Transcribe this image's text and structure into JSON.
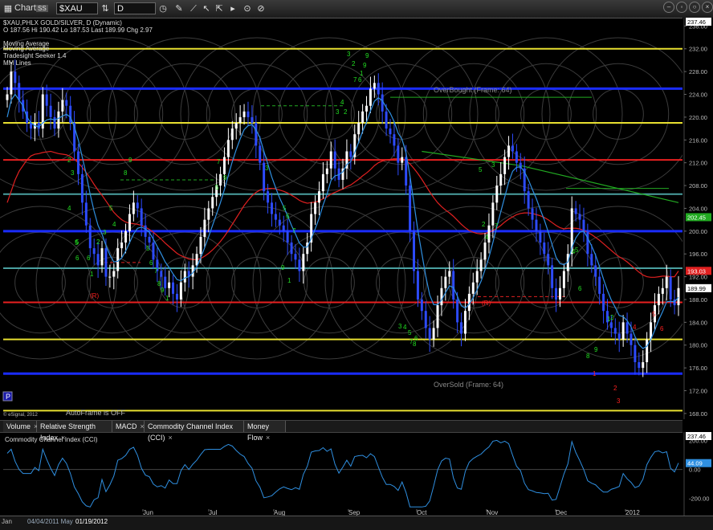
{
  "toolbar": {
    "chart_label": "Chart",
    "chart_badge": "SS",
    "symbol": "$XAU",
    "interval": "D"
  },
  "header": {
    "title_line": "$XAU,PHLX GOLD/SILVER, D (Dynamic)",
    "ohlc": "O  187.56  Hi  190.42   Lo  187.53   Last  189.99   Chg  2.97",
    "studies": [
      "Moving Average",
      "Moving Average",
      "Tradesight Seeker 1.4",
      "MM Lines"
    ]
  },
  "annotations": {
    "overbought": "OverBought (Frame: 64)",
    "oversold": "OverSold (Frame: 64)",
    "autoframe": "AutoFrame is OFF",
    "copyright": "© eSignal, 2012",
    "p_button": "P"
  },
  "colors": {
    "background": "#000000",
    "up_candle": "#ffffff",
    "down_candle": "#2d4bff",
    "ma_fast": "#2f8fe0",
    "ma_slow_red": "#e02020",
    "ma_slow_green": "#22aa22",
    "mm_yellow": "#e8e030",
    "mm_red": "#e82020",
    "mm_blue": "#1a2cff",
    "mm_teal": "#4aa0a0",
    "mm_green": "#228822",
    "cci_line": "#2f8fe0",
    "seeker_green": "#22dd22",
    "seeker_red": "#ff2020"
  },
  "tabs": [
    {
      "label": "Volume"
    },
    {
      "label": "Relative Strength Index"
    },
    {
      "label": "MACD"
    },
    {
      "label": "Commodity Channel Index (CCI)"
    },
    {
      "label": "Money Flow"
    }
  ],
  "chart_data": [
    {
      "type": "candlestick",
      "title": "$XAU,PHLX GOLD/SILVER, D (Dynamic)",
      "y_axis": {
        "ylim": [
          167,
          237.46
        ],
        "ticks": [
          168,
          172,
          176,
          180,
          184,
          188,
          192,
          196,
          200,
          204,
          208,
          212,
          216,
          220,
          224,
          228,
          232,
          236
        ]
      },
      "x_ticks": [
        "Jun",
        "Jul",
        "Aug",
        "Sep",
        "Oct",
        "Nov",
        "Dec",
        "2012"
      ],
      "badges": [
        {
          "value": "237.46",
          "color": "#ffffff"
        },
        {
          "value": "202.45",
          "color": "#22aa22"
        },
        {
          "value": "193.03",
          "color": "#e02020"
        },
        {
          "value": "189.99",
          "color": "#ffffff"
        }
      ],
      "horizontal_lines": [
        {
          "value": 232,
          "color": "#e8e030"
        },
        {
          "value": 225,
          "color": "#1a2cff"
        },
        {
          "value": 219,
          "color": "#e8e030"
        },
        {
          "value": 212.5,
          "color": "#e82020"
        },
        {
          "value": 206.5,
          "color": "#4aa0a0"
        },
        {
          "value": 200,
          "color": "#1a2cff"
        },
        {
          "value": 193.5,
          "color": "#4aa0a0"
        },
        {
          "value": 187.5,
          "color": "#e82020"
        },
        {
          "value": 181,
          "color": "#e8e030"
        },
        {
          "value": 175,
          "color": "#1a2cff"
        },
        {
          "value": 168.5,
          "color": "#e8e030"
        }
      ],
      "close": [
        224,
        228,
        226,
        223,
        221,
        219,
        218,
        219,
        218,
        224,
        222,
        220,
        218,
        221,
        223,
        222,
        219,
        214,
        210,
        205,
        201,
        197,
        196,
        194,
        197,
        192,
        192,
        193,
        197,
        198,
        200,
        203,
        205,
        204,
        201,
        199,
        198,
        195,
        193,
        192,
        190,
        191,
        189,
        188,
        191,
        193,
        192,
        194,
        196,
        199,
        202,
        204,
        206,
        208,
        210,
        213,
        216,
        218,
        219,
        220,
        221,
        220,
        219,
        215,
        212,
        207,
        205,
        203,
        202,
        201,
        200,
        198,
        196,
        195,
        193,
        196,
        198,
        203,
        205,
        207,
        210,
        211,
        214,
        211,
        209,
        211,
        214,
        213,
        217,
        219,
        221,
        222,
        225,
        226,
        224,
        221,
        218,
        217,
        215,
        212,
        213,
        208,
        200,
        193,
        188,
        186,
        183,
        181,
        183,
        187,
        190,
        192,
        193,
        188,
        184,
        182,
        186,
        189,
        191,
        193,
        195,
        198,
        201,
        205,
        208,
        210,
        213,
        215,
        214,
        212,
        211,
        207,
        204,
        202,
        200,
        198,
        196,
        194,
        190,
        188,
        190,
        193,
        196,
        204,
        203,
        202,
        200,
        196,
        194,
        192,
        189,
        186,
        184,
        183,
        182,
        181,
        184,
        182,
        180,
        177,
        176,
        177,
        181,
        184,
        187,
        189,
        190,
        192,
        188,
        187,
        190
      ],
      "ma_fast": [
        220,
        223,
        224,
        223,
        222,
        220,
        219,
        218.5,
        218.3,
        219,
        219.5,
        219.7,
        219.5,
        219.8,
        220.2,
        220.5,
        220,
        218.3,
        216,
        213,
        210,
        206.5,
        203.5,
        201,
        199.5,
        197.5,
        195.8,
        194.6,
        194.7,
        195.3,
        196.5,
        198,
        199.5,
        200.5,
        200.7,
        200.4,
        199.8,
        198.6,
        197.3,
        196,
        194.6,
        193.6,
        192.5,
        191.5,
        191.3,
        191.8,
        192,
        192.7,
        193.7,
        195.3,
        197.1,
        199,
        201,
        203,
        205,
        207.3,
        209.8,
        212.2,
        214.3,
        216.2,
        217.8,
        218.5,
        218.7,
        217.8,
        216.4,
        214,
        211.8,
        209.5,
        207.6,
        205.8,
        204.3,
        202.7,
        201,
        199.5,
        197.9,
        197.2,
        197.2,
        198.7,
        200.4,
        202.3,
        204.6,
        206.5,
        208.9,
        209.7,
        209.9,
        210.4,
        211.7,
        212.2,
        213.8,
        215.6,
        217.5,
        219.1,
        221.1,
        222.8,
        223.4,
        222.9,
        221.7,
        220.7,
        219.2,
        217.2,
        216.1,
        213.7,
        209.7,
        204.9,
        200.1,
        196.1,
        192.1,
        188.8,
        187.1,
        187.1,
        187.9,
        189.2,
        190.4,
        190.1,
        188.6,
        186.9,
        186.5,
        187.2,
        188.3,
        189.7,
        191.2,
        193.2,
        195.4,
        198,
        200.8,
        203.4,
        206,
        208.6,
        210.5,
        211.2,
        211.3,
        210.4,
        209,
        207.3,
        205.7,
        203.8,
        202,
        199.9,
        197.6,
        195.4,
        194.3,
        194.1,
        194.6,
        197.1,
        198.8,
        199.8,
        200,
        198.8,
        197.4,
        195.8,
        193.8,
        191.6,
        189.6,
        187.9,
        186.6,
        185.2,
        185,
        184.3,
        183.2,
        181.5,
        180.1,
        179.4,
        179.8,
        181,
        182.6,
        184.4,
        185.9,
        187.6,
        187.7,
        187.6,
        188.4
      ],
      "ma_slow": [
        205,
        207,
        209,
        210.5,
        211.5,
        212.5,
        213.2,
        213.5,
        213.6,
        213.8,
        213.9,
        214,
        213.8,
        213.6,
        213.5,
        213.4,
        213.1,
        212.6,
        212,
        211.2,
        210.3,
        209.3,
        208.2,
        207.2,
        206.3,
        205.3,
        204.3,
        203.3,
        202.6,
        202,
        201.6,
        201.4,
        201.3,
        201.2,
        201,
        200.7,
        200.3,
        199.8,
        199.2,
        198.6,
        197.9,
        197.3,
        196.7,
        196.1,
        195.7,
        195.4,
        195.1,
        195,
        195,
        195.2,
        195.6,
        196.1,
        196.7,
        197.4,
        198.2,
        199.1,
        200.1,
        201.2,
        202.3,
        203.4,
        204.5,
        205.4,
        206.2,
        206.8,
        207.2,
        207.4,
        207.5,
        207.5,
        207.4,
        207.2,
        207,
        206.7,
        206.3,
        205.9,
        205.4,
        205.1,
        204.9,
        205,
        205.1,
        205.3,
        205.7,
        206,
        206.5,
        206.8,
        207.1,
        207.4,
        207.8,
        208.1,
        208.6,
        209.1,
        209.7,
        210.2,
        210.8,
        211.5,
        212,
        212.3,
        212.5,
        212.6,
        212.7,
        212.7,
        212.7,
        212.4,
        211.8,
        211,
        210.1,
        209.1,
        208,
        206.9,
        205.9,
        205,
        204.3,
        203.7,
        203.2,
        202.6,
        201.9,
        201.2,
        200.6,
        200.1,
        199.8,
        199.6,
        199.5,
        199.6,
        199.8,
        200.1,
        200.5,
        201,
        201.6,
        202.1,
        202.5,
        202.9,
        203.1,
        203.2,
        203.2,
        203.1,
        202.9,
        202.7,
        202.4,
        202,
        201.5,
        201,
        200.6,
        200.4,
        200.5,
        200.5,
        200.5,
        200.4,
        200.1,
        199.8,
        199.4,
        198.9,
        198.4,
        197.8,
        197.2,
        196.6,
        196,
        195.5,
        195.1,
        194.6,
        194,
        193.4,
        192.8,
        192.3,
        192,
        191.9,
        191.9,
        192,
        192.1,
        192.1,
        192,
        192,
        193
      ],
      "ma_slow_green": [
        {
          "x": 105,
          "y": 214
        },
        {
          "x": 130,
          "y": 211.5
        },
        {
          "x": 170,
          "y": 205
        }
      ],
      "seeker_labels_green": [
        "1",
        "2",
        "3",
        "4",
        "5",
        "6",
        "7",
        "8",
        "9"
      ],
      "seeker_labels_red": [
        "(R)",
        "1",
        "2",
        "3",
        "4",
        "5",
        "6"
      ]
    },
    {
      "type": "line",
      "title": "Commodity Channel Index (CCI)",
      "y_axis": {
        "ylim": [
          -275,
          237.46
        ],
        "ticks": [
          -200.0,
          0.0,
          200.0
        ]
      },
      "badges": [
        {
          "value": "237.46",
          "color": "#ffffff"
        },
        {
          "value": "44.09",
          "color": "#2f8fe0"
        }
      ],
      "x_ticks": [
        "Jun",
        "Jul",
        "Aug",
        "Sep",
        "Oct",
        "Nov",
        "Dec",
        "2012"
      ]
    }
  ],
  "bottom": {
    "date_left": "04/04/2011 May",
    "date_right": "01/19/2012",
    "left_label": "Jan"
  }
}
